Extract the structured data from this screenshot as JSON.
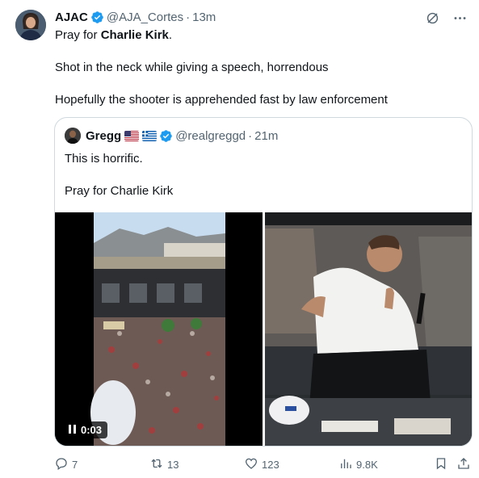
{
  "tweet": {
    "author_name": "AJAC",
    "author_handle": "@AJA_Cortes",
    "separator": "·",
    "time": "13m",
    "line1_prefix": "Pray for ",
    "line1_bold": "Charlie Kirk",
    "line1_suffix": ".",
    "line2": "Shot in the neck while giving a speech, horrendous",
    "line3": "Hopefully the shooter is apprehended fast by law enforcement"
  },
  "quote": {
    "author_name": "Gregg",
    "author_handle": "@realgreggd",
    "separator": "·",
    "time": "21m",
    "line1": "This is horrific.",
    "line2": "Pray for Charlie Kirk",
    "video_timer": "0:03"
  },
  "actions": {
    "replies": "7",
    "reposts": "13",
    "likes": "123",
    "views": "9.8K"
  },
  "colors": {
    "verified": "#1d9bf0",
    "muted": "#536471",
    "border": "#cfd9de"
  },
  "icons": [
    "verified-badge-icon",
    "grok-icon",
    "more-icon",
    "reply-icon",
    "repost-icon",
    "like-icon",
    "views-icon",
    "bookmark-icon",
    "share-icon",
    "pause-icon",
    "us-flag-icon",
    "greece-flag-icon"
  ]
}
